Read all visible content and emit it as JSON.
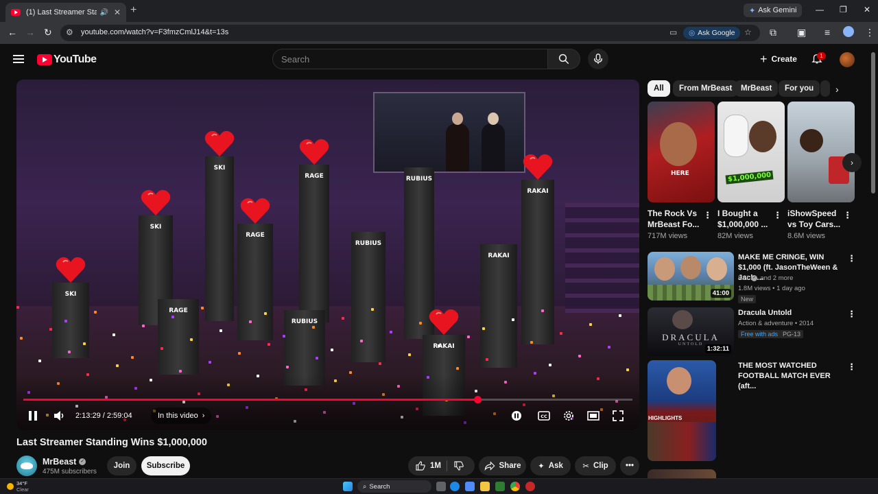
{
  "browser": {
    "tab_title": "(1) Last Streamer Standing",
    "url": "youtube.com/watch?v=F3fmzCmlJ14&t=13s",
    "ask_gemini": "Ask Gemini",
    "ask_google": "Ask Google"
  },
  "header": {
    "logo": "YouTube",
    "search_placeholder": "Search",
    "create_label": "Create",
    "notification_count": "1"
  },
  "player": {
    "time": "2:13:29 / 2:59:04",
    "in_this_video": "In this video",
    "progress": 0.745,
    "pillar_names": [
      "SKI",
      "SKI",
      "RAGE",
      "RAGE",
      "RAGE",
      "RUBIUS",
      "RUBIUS",
      "RUBIUS",
      "RAKAI",
      "RAKAI",
      "RAKAI"
    ]
  },
  "video": {
    "title": "Last Streamer Standing Wins $1,000,000",
    "channel": "MrBeast",
    "subscribers": "475M subscribers",
    "join_label": "Join",
    "subscribe_label": "Subscribe",
    "likes": "1M",
    "share_label": "Share",
    "ask_label": "Ask",
    "clip_label": "Clip"
  },
  "sidebar": {
    "chips": [
      "All",
      "From MrBeast",
      "MrBeast",
      "For you"
    ],
    "shorts": [
      {
        "title": "The Rock Vs MrBeast Fo...",
        "views": "717M views",
        "overlay": "HERE"
      },
      {
        "title": "I Bought a $1,000,000 ...",
        "views": "82M views",
        "overlay": "$1,000,000"
      },
      {
        "title": "iShowSpeed vs Toy Cars...",
        "views": "8.6M views",
        "overlay": ""
      }
    ],
    "recs": [
      {
        "title": "MAKE ME CRINGE, WIN $1,000 (ft. JasonTheWeen & Jack ...",
        "channel": "KSI",
        "extra": "and 2 more",
        "meta": "1.8M views • 1 day ago",
        "badge": "New",
        "duration": "41:00"
      },
      {
        "title": "Dracula Untold",
        "meta": "Action & adventure • 2014",
        "free": "Free with ads",
        "rating": "PG-13",
        "duration": "1:32:11",
        "thumb_text": "DRACULA",
        "thumb_sub": "UNTOLD"
      },
      {
        "title": "THE MOST WATCHED FOOTBALL MATCH EVER (aft...",
        "thumb_text": "HIGHLIGHTS"
      }
    ]
  },
  "taskbar": {
    "temp": "34°F",
    "weather": "Clear",
    "search": "Search"
  },
  "colors": {
    "accent_red": "#ff0033",
    "bg": "#0f0f0f",
    "chip_bg": "#272727",
    "link_blue": "#3ea6ff"
  }
}
